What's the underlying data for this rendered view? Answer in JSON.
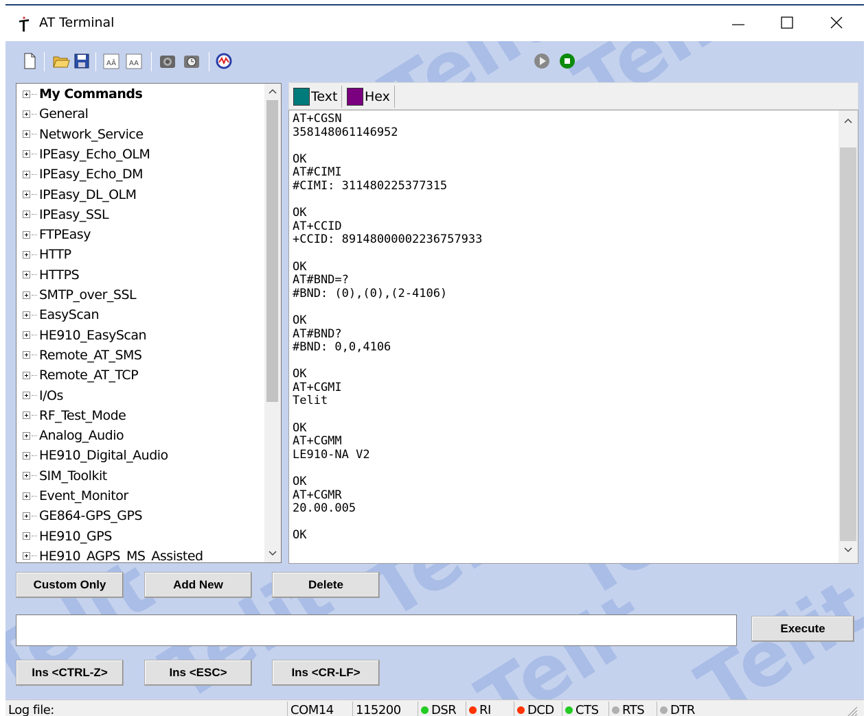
{
  "window": {
    "title": "AT Terminal"
  },
  "toolbar": {
    "icons": [
      "new-file-icon",
      "open-folder-icon",
      "save-icon",
      "font-increase-icon",
      "font-decrease-icon",
      "connect-icon",
      "settings-icon",
      "monitor-icon",
      "play-icon",
      "stop-icon"
    ]
  },
  "tree": {
    "items": [
      {
        "label": "My Commands",
        "bold": true
      },
      {
        "label": "General"
      },
      {
        "label": "Network_Service"
      },
      {
        "label": "IPEasy_Echo_OLM"
      },
      {
        "label": "IPEasy_Echo_DM"
      },
      {
        "label": "IPEasy_DL_OLM"
      },
      {
        "label": "IPEasy_SSL"
      },
      {
        "label": "FTPEasy"
      },
      {
        "label": "HTTP"
      },
      {
        "label": "HTTPS"
      },
      {
        "label": "SMTP_over_SSL"
      },
      {
        "label": "EasyScan"
      },
      {
        "label": "HE910_EasyScan"
      },
      {
        "label": "Remote_AT_SMS"
      },
      {
        "label": "Remote_AT_TCP"
      },
      {
        "label": "I/Os"
      },
      {
        "label": "RF_Test_Mode"
      },
      {
        "label": "Analog_Audio"
      },
      {
        "label": "HE910_Digital_Audio"
      },
      {
        "label": "SIM_Toolkit"
      },
      {
        "label": "Event_Monitor"
      },
      {
        "label": "GE864-GPS_GPS"
      },
      {
        "label": "HE910_GPS"
      },
      {
        "label": "HE910_AGPS_MS_Assisted"
      }
    ]
  },
  "tabs": [
    {
      "label": "Text",
      "color": "#007b7b"
    },
    {
      "label": "Hex",
      "color": "#7b0080"
    }
  ],
  "terminal": {
    "lines": [
      "AT+CGSN",
      "358148061146952",
      "",
      "OK",
      "AT#CIMI",
      "#CIMI: 311480225377315",
      "",
      "OK",
      "AT+CCID",
      "+CCID: 89148000002236757933",
      "",
      "OK",
      "AT#BND=?",
      "#BND: (0),(0),(2-4106)",
      "",
      "OK",
      "AT#BND?",
      "#BND: 0,0,4106",
      "",
      "OK",
      "AT+CGMI",
      "Telit",
      "",
      "OK",
      "AT+CGMM",
      "LE910-NA V2",
      "",
      "OK",
      "AT+CGMR",
      "20.00.005",
      "",
      "OK"
    ]
  },
  "buttons": {
    "custom_only": "Custom Only",
    "add_new": "Add New",
    "delete": "Delete",
    "execute": "Execute",
    "ins_ctrl_z": "Ins <CTRL-Z>",
    "ins_esc": "Ins <ESC>",
    "ins_cr_lf": "Ins <CR-LF>"
  },
  "command_input": {
    "value": ""
  },
  "watermark": "Telit",
  "statusbar": {
    "log_file": "Log file:",
    "port": "COM14",
    "baud": "115200",
    "signals": [
      {
        "label": "DSR",
        "color": "#22cc22"
      },
      {
        "label": "RI",
        "color": "#ff3300"
      },
      {
        "label": "DCD",
        "color": "#ff3300"
      },
      {
        "label": "CTS",
        "color": "#22cc22"
      },
      {
        "label": "RTS",
        "color": "#b0b0b0"
      },
      {
        "label": "DTR",
        "color": "#b0b0b0"
      }
    ]
  }
}
